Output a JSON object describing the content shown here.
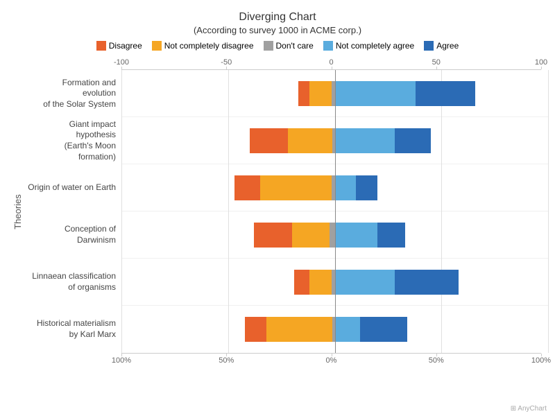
{
  "title": "Diverging Chart",
  "subtitle": "(According to survey 1000 in ACME corp.)",
  "colors": {
    "disagree": "#E8612C",
    "not_completely_disagree": "#F5A623",
    "dont_care": "#A0A0A0",
    "not_completely_agree": "#5AACDE",
    "agree": "#2B6BB5"
  },
  "legend": [
    {
      "label": "Disagree",
      "color": "#E8612C"
    },
    {
      "label": "Not completely disagree",
      "color": "#F5A623"
    },
    {
      "label": "Don't care",
      "color": "#A0A0A0"
    },
    {
      "label": "Not completely agree",
      "color": "#5AACDE"
    },
    {
      "label": "Agree",
      "color": "#2B6BB5"
    }
  ],
  "y_axis_label": "Theories",
  "x_axis_top": [
    "-100",
    "-50",
    "0",
    "50",
    "100"
  ],
  "x_axis_bottom": [
    "100%",
    "50%",
    "0%",
    "50%",
    "100%"
  ],
  "rows": [
    {
      "label": "Formation and evolution\nof the Solar System",
      "disagree": 5,
      "not_completely_disagree": 12,
      "dont_care": 3,
      "not_completely_agree": 38,
      "agree": 28
    },
    {
      "label": "Giant impact hypothesis\n(Earth's Moon formation)",
      "disagree": 18,
      "not_completely_disagree": 22,
      "dont_care": 2,
      "not_completely_agree": 28,
      "agree": 17
    },
    {
      "label": "Origin of water on Earth",
      "disagree": 12,
      "not_completely_disagree": 35,
      "dont_care": 3,
      "not_completely_agree": 10,
      "agree": 10
    },
    {
      "label": "Conception of Darwinism",
      "disagree": 18,
      "not_completely_disagree": 20,
      "dont_care": 5,
      "not_completely_agree": 20,
      "agree": 13
    },
    {
      "label": "Linnaean classification\nof organisms",
      "disagree": 7,
      "not_completely_disagree": 12,
      "dont_care": 3,
      "not_completely_agree": 28,
      "agree": 30
    },
    {
      "label": "Historical materialism\nby Karl Marx",
      "disagree": 10,
      "not_completely_disagree": 32,
      "dont_care": 2,
      "not_completely_agree": 12,
      "agree": 22
    }
  ]
}
